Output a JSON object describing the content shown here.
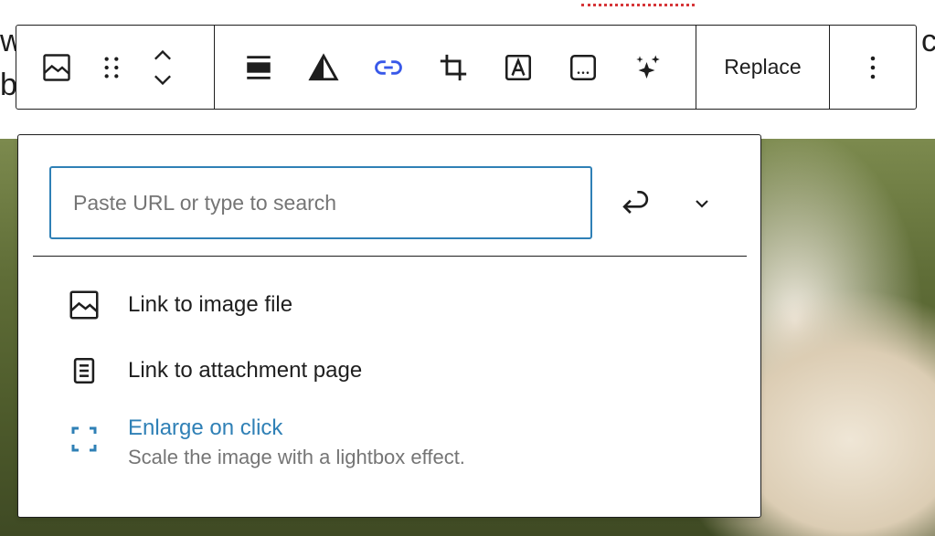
{
  "toolbar": {
    "buttons": {
      "parent": "image-icon",
      "drag": "drag-handle-icon",
      "move_up": "chevron-up-icon",
      "move_down": "chevron-down-icon",
      "align": "align-full-width-icon",
      "duotone": "duotone-filter-icon",
      "link": "link-icon",
      "crop": "crop-icon",
      "text_overlay": "text-overlay-icon",
      "alt_text": "alt-text-icon",
      "ai": "sparkles-icon",
      "more": "more-vertical-icon"
    },
    "replace_label": "Replace"
  },
  "link_popover": {
    "search": {
      "placeholder": "Paste URL or type to search",
      "value": ""
    },
    "submit_icon": "return-arrow-icon",
    "settings_icon": "chevron-down-icon",
    "options": [
      {
        "icon": "image-icon",
        "label": "Link to image file"
      },
      {
        "icon": "page-icon",
        "label": "Link to attachment page"
      },
      {
        "icon": "fullscreen-icon",
        "label": "Enlarge on click",
        "description": "Scale the image with a lightbox effect."
      }
    ]
  },
  "colors": {
    "text": "#1e1e1e",
    "accent": "#2f80b6",
    "active_icon": "#3858e9",
    "muted": "#757575",
    "spell_error": "#d63638"
  }
}
